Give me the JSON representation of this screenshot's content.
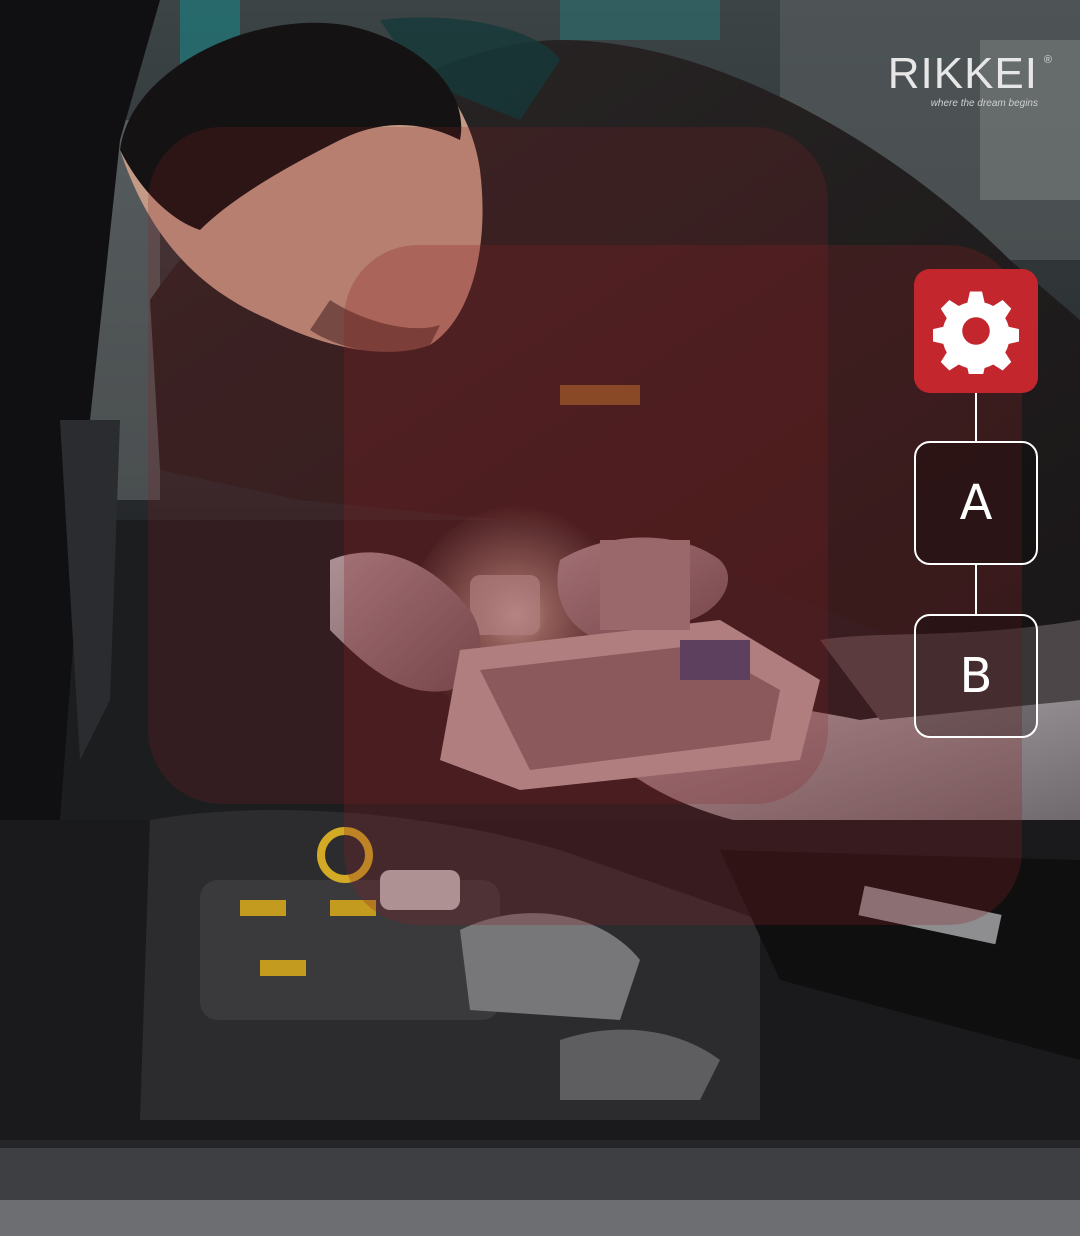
{
  "brand": {
    "logo_text": "RIKKEI",
    "registered_mark": "®",
    "tagline": "where the dream begins"
  },
  "flow": {
    "gear_node": {
      "icon": "gear-icon",
      "color": "#c4262e"
    },
    "nodes": [
      {
        "label": "A"
      },
      {
        "label": "B"
      }
    ]
  },
  "photo": {
    "subject": "mechanic-working-on-car-engine",
    "overlay_color": "#8a1f24"
  }
}
